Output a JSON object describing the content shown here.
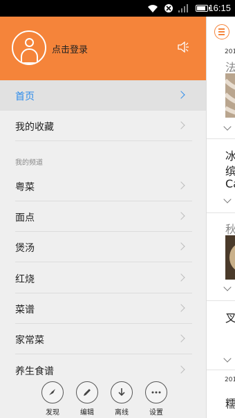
{
  "status_bar": {
    "time": "16:15"
  },
  "header": {
    "login_label": "点击登录"
  },
  "nav": {
    "home": {
      "label": "首页",
      "active": true
    },
    "favorites": {
      "label": "我的收藏"
    },
    "section_title": "我的频道",
    "channels": [
      {
        "label": "粤菜"
      },
      {
        "label": "面点"
      },
      {
        "label": "煲汤"
      },
      {
        "label": "红烧"
      },
      {
        "label": "菜谱"
      },
      {
        "label": "家常菜"
      },
      {
        "label": "养生食谱"
      }
    ]
  },
  "toolbar": {
    "items": [
      {
        "label": "发现",
        "icon": "compass-icon"
      },
      {
        "label": "编辑",
        "icon": "pencil-icon"
      },
      {
        "label": "离线",
        "icon": "download-icon"
      },
      {
        "label": "设置",
        "icon": "more-icon"
      }
    ]
  },
  "content": {
    "items": [
      {
        "date": "201",
        "title": "法"
      },
      {
        "title": "冰"
      },
      {
        "title": "缤"
      },
      {
        "title": "Ca"
      },
      {
        "title": "秋"
      },
      {
        "title": "叉"
      },
      {
        "date": "201",
        "title": "糯"
      }
    ]
  },
  "colors": {
    "accent": "#f5843a",
    "active_link": "#2d8ceb",
    "drawer_bg": "#efefef"
  }
}
